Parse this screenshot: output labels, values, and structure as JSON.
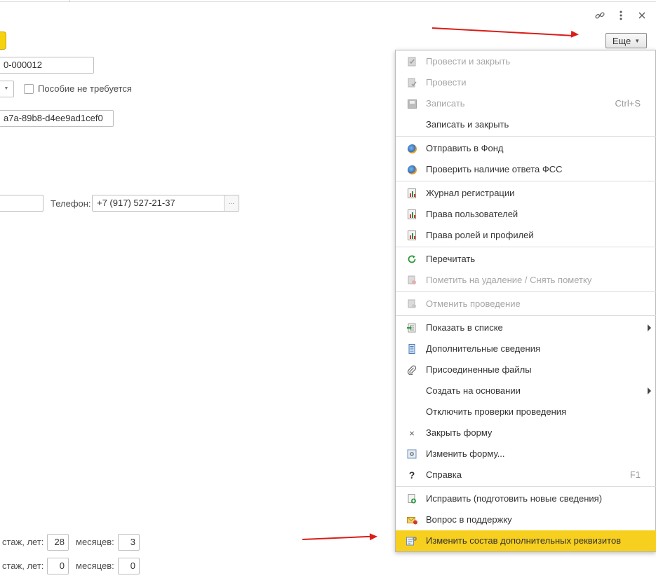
{
  "form": {
    "number_value": "0-000012",
    "checkbox_label": "Пособие не требуется",
    "uuid_value": "a7a-89b8-d4ee9ad1cef0",
    "phone_label": "Телефон:",
    "phone_value": "+7 (917) 527-21-37",
    "phone_button": "...",
    "experience1_label": "стаж, лет:",
    "experience1_years": "28",
    "experience1_months_label": "месяцев:",
    "experience1_months": "3",
    "experience2_label": "стаж, лет:",
    "experience2_years": "0",
    "experience2_months_label": "месяцев:",
    "experience2_months": "0"
  },
  "window_controls": {
    "link_icon": "link-icon",
    "more_icon": "more-vertical-icon",
    "close_icon": "close-icon"
  },
  "more_button": {
    "label": "Еще"
  },
  "menu": {
    "items": [
      {
        "label": "Провести и закрыть",
        "icon": "post-close-icon",
        "disabled": true
      },
      {
        "label": "Провести",
        "icon": "post-icon",
        "disabled": true
      },
      {
        "label": "Записать",
        "icon": "save-icon",
        "disabled": true,
        "shortcut": "Ctrl+S"
      },
      {
        "label": "Записать и закрыть",
        "disabled": false
      },
      {
        "label": "Отправить в Фонд",
        "icon": "fund-send-icon"
      },
      {
        "label": "Проверить наличие ответа ФСС",
        "icon": "fss-check-icon"
      },
      {
        "label": "Журнал регистрации",
        "icon": "report-icon"
      },
      {
        "label": "Права пользователей",
        "icon": "report-icon"
      },
      {
        "label": "Права ролей и профилей",
        "icon": "report-icon"
      },
      {
        "label": "Перечитать",
        "icon": "refresh-icon"
      },
      {
        "label": "Пометить на удаление / Снять пометку",
        "icon": "mark-delete-icon",
        "disabled": true
      },
      {
        "label": "Отменить проведение",
        "icon": "unpost-icon",
        "disabled": true
      },
      {
        "label": "Показать в списке",
        "icon": "show-in-list-icon",
        "submenu": true
      },
      {
        "label": "Дополнительные сведения",
        "icon": "additional-info-icon"
      },
      {
        "label": "Присоединенные файлы",
        "icon": "paperclip-icon"
      },
      {
        "label": "Создать на основании",
        "submenu": true
      },
      {
        "label": "Отключить проверки проведения"
      },
      {
        "label": "Закрыть форму",
        "icon": "close-icon"
      },
      {
        "label": "Изменить форму...",
        "icon": "edit-form-icon"
      },
      {
        "label": "Справка",
        "icon": "help-icon",
        "shortcut": "F1"
      },
      {
        "label": "Исправить (подготовить новые сведения)",
        "icon": "fix-doc-icon"
      },
      {
        "label": "Вопрос в поддержку",
        "icon": "support-mail-icon"
      },
      {
        "label": "Изменить состав дополнительных реквизитов",
        "icon": "settings-icon",
        "highlighted": true
      }
    ]
  },
  "colors": {
    "accent_yellow": "#f7cf1e",
    "annotation_red": "#d91e18",
    "disabled_text": "#a6a6a6"
  }
}
